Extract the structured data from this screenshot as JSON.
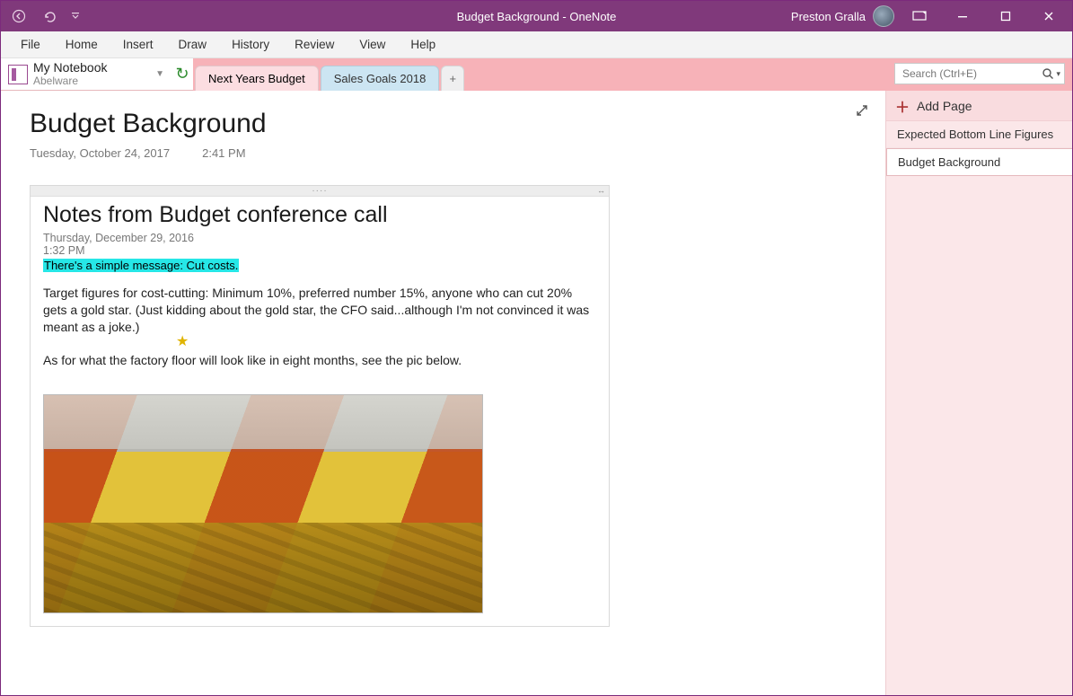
{
  "titlebar": {
    "title": "Budget Background  -  OneNote",
    "user": "Preston Gralla"
  },
  "menu": [
    "File",
    "Home",
    "Insert",
    "Draw",
    "History",
    "Review",
    "View",
    "Help"
  ],
  "notebook": {
    "title": "My Notebook",
    "section": "Abelware"
  },
  "tabs": [
    {
      "label": "Next Years Budget"
    },
    {
      "label": "Sales Goals 2018"
    }
  ],
  "search": {
    "placeholder": "Search (Ctrl+E)"
  },
  "page": {
    "title": "Budget Background",
    "date": "Tuesday, October 24, 2017",
    "time": "2:41 PM"
  },
  "note": {
    "title": "Notes from Budget conference call",
    "date": "Thursday, December 29, 2016",
    "time": "1:32 PM",
    "highlight": "There's a simple message: Cut costs.",
    "para1": "Target figures for cost-cutting: Minimum 10%, preferred number 15%, anyone who can cut 20% gets a gold star. (Just kidding about the gold star, the CFO said...although I'm not convinced it was meant as a joke.)",
    "para2": "As for what the factory floor will look like in eight months, see the pic below."
  },
  "rightpane": {
    "add": "Add Page",
    "pages": [
      "Expected Bottom Line Figures",
      "Budget Background"
    ]
  }
}
